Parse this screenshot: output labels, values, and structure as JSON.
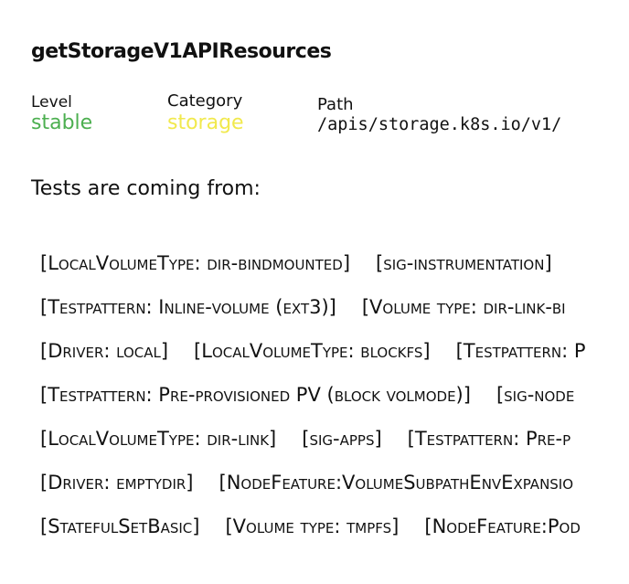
{
  "endpoint": {
    "title": "getStorageV1APIResources"
  },
  "meta": {
    "level_label": "Level",
    "level_value": "stable",
    "category_label": "Category",
    "category_value": "storage",
    "path_label": "Path",
    "path_value": "/apis/storage.k8s.io/v1/"
  },
  "colors": {
    "level": "#4caf50",
    "category": "#f1e94d"
  },
  "tests_heading": "Tests are coming from:",
  "test_rows": [
    [
      "[LocalVolumeType: dir-bindmounted]",
      "[sig-instrumentation]"
    ],
    [
      "[Testpattern: Inline-volume (ext3)]",
      "[Volume type: dir-link-bi"
    ],
    [
      "[Driver: local]",
      "[LocalVolumeType: blockfs]",
      "[Testpattern: P"
    ],
    [
      "[Testpattern: Pre-provisioned PV (block volmode)]",
      "[sig-node"
    ],
    [
      "[LocalVolumeType: dir-link]",
      "[sig-apps]",
      "[Testpattern: Pre-p"
    ],
    [
      "[Driver: emptydir]",
      "[NodeFeature:VolumeSubpathEnvExpansio"
    ],
    [
      "[StatefulSetBasic]",
      "[Volume type: tmpfs]",
      "[NodeFeature:Pod"
    ]
  ]
}
